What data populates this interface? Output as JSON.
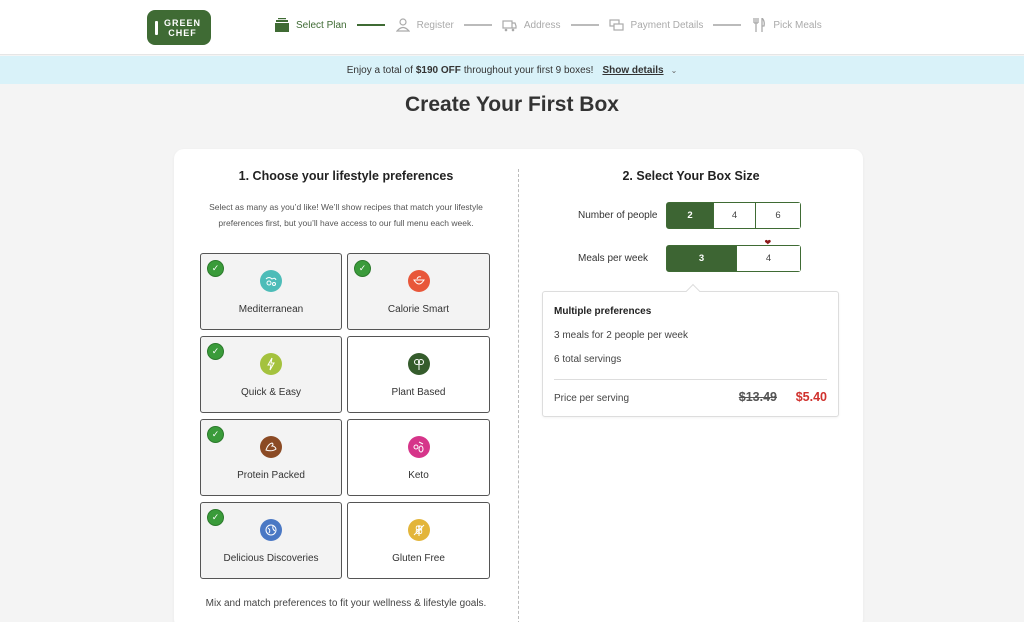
{
  "header": {
    "logo": {
      "line1": "GREEN",
      "line2": "CHEF",
      "color": "#3f6b34"
    },
    "steps": [
      {
        "label": "Select Plan",
        "icon": "box-stack-icon",
        "active": true
      },
      {
        "label": "Register",
        "icon": "user-icon",
        "active": false
      },
      {
        "label": "Address",
        "icon": "truck-icon",
        "active": false
      },
      {
        "label": "Payment Details",
        "icon": "cards-icon",
        "active": false
      },
      {
        "label": "Pick Meals",
        "icon": "fork-knife-icon",
        "active": false
      }
    ]
  },
  "promo": {
    "prefix": "Enjoy a total of",
    "highlight": "$190 OFF",
    "suffix": "throughout your first 9 boxes!",
    "link": "Show details",
    "background": "#d9f2f9"
  },
  "page": {
    "title": "Create Your First Box"
  },
  "preferences": {
    "title": "1. Choose your lifestyle preferences",
    "description": "Select as many as you’d like! We’ll show recipes that match your lifestyle preferences first, but you’ll have access to our full menu each week.",
    "items": [
      {
        "label": "Mediterranean",
        "selected": true,
        "icon": "mediterranean-icon",
        "color": "#4dbcb8"
      },
      {
        "label": "Calorie Smart",
        "selected": true,
        "icon": "calorie-smart-icon",
        "color": "#e8573a"
      },
      {
        "label": "Quick & Easy",
        "selected": true,
        "icon": "lightning-icon",
        "color": "#a4c23e"
      },
      {
        "label": "Plant Based",
        "selected": false,
        "icon": "broccoli-icon",
        "color": "#355c2c"
      },
      {
        "label": "Protein Packed",
        "selected": true,
        "icon": "muscle-icon",
        "color": "#8b4a24"
      },
      {
        "label": "Keto",
        "selected": false,
        "icon": "keto-icon",
        "color": "#d6358a"
      },
      {
        "label": "Delicious Discoveries",
        "selected": true,
        "icon": "globe-icon",
        "color": "#4a78c4"
      },
      {
        "label": "Gluten Free",
        "selected": false,
        "icon": "wheat-icon",
        "color": "#e3b53a"
      }
    ],
    "footer": "Mix and match preferences to fit your wellness & lifestyle goals."
  },
  "box_size": {
    "title": "2. Select Your Box Size",
    "people": {
      "label": "Number of people",
      "options": [
        "2",
        "4",
        "6"
      ],
      "selected": "2"
    },
    "meals": {
      "label": "Meals per week",
      "options": [
        "3",
        "4"
      ],
      "selected": "3",
      "favorite": "4"
    },
    "summary": {
      "title": "Multiple preferences",
      "line1": "3 meals for 2 people per week",
      "line2": "6 total servings",
      "price_label": "Price per serving",
      "old_price": "$13.49",
      "new_price": "$5.40"
    }
  }
}
